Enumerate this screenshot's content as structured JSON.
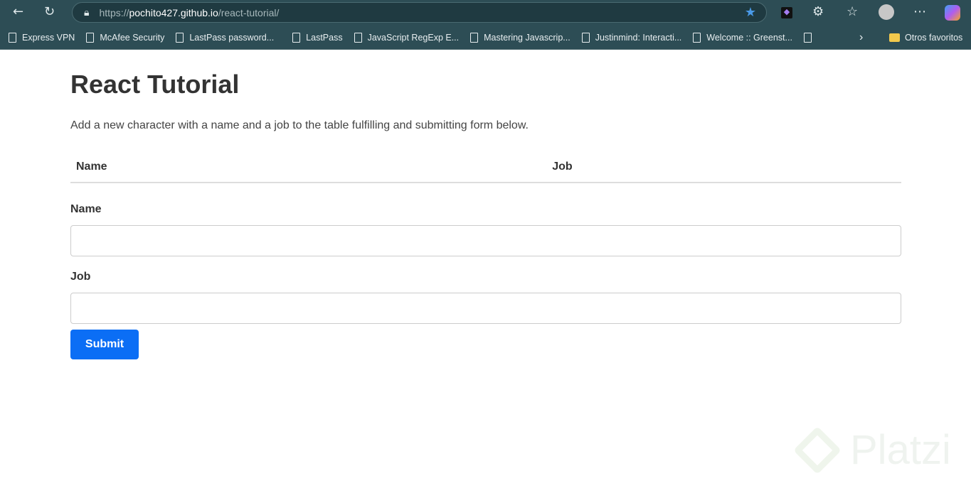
{
  "browser": {
    "url_scheme": "https://",
    "url_host": "pochito427.github.io",
    "url_path": "/react-tutorial/",
    "bookmarks": [
      "Express VPN",
      "McAfee Security",
      "LastPass password...",
      "LastPass",
      "JavaScript RegExp E...",
      "Mastering Javascrip...",
      "Justinmind: Interacti...",
      "Welcome :: Greenst...",
      ""
    ],
    "other_favorites": "Otros favoritos"
  },
  "page": {
    "title": "React Tutorial",
    "description": "Add a new character with a name and a job to the table fulfilling and submitting form below.",
    "table_headers": [
      "Name",
      "Job"
    ],
    "form": {
      "name_label": "Name",
      "name_value": "",
      "job_label": "Job",
      "job_value": "",
      "submit": "Submit"
    }
  },
  "watermark": "Platzi"
}
